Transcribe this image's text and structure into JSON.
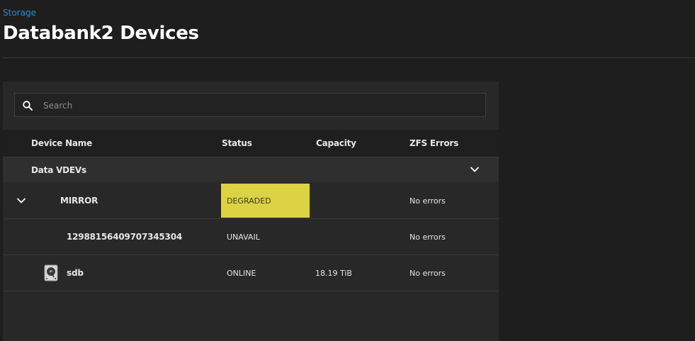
{
  "breadcrumb": "Storage",
  "page_title": "Databank2 Devices",
  "search": {
    "placeholder": "Search",
    "value": ""
  },
  "table": {
    "columns": [
      "Device Name",
      "Status",
      "Capacity",
      "ZFS Errors"
    ],
    "group": {
      "label": "Data VDEVs",
      "toggle_icon": "chevron-down-icon"
    },
    "rows": [
      {
        "name": "MIRROR",
        "status": "DEGRADED",
        "capacity": "",
        "errors": "No errors",
        "icon": "chevron-down-icon"
      },
      {
        "name": "12988156409707345304",
        "status": "UNAVAIL",
        "capacity": "",
        "errors": "No errors",
        "icon": ""
      },
      {
        "name": "sdb",
        "status": "ONLINE",
        "capacity": "18.19 TiB",
        "errors": "No errors",
        "icon": "hard-disk-icon"
      }
    ]
  },
  "colors": {
    "accent": "#1f8fd8",
    "degraded": "#dbd343",
    "background": "#1e1e1e",
    "panel": "#282828"
  }
}
